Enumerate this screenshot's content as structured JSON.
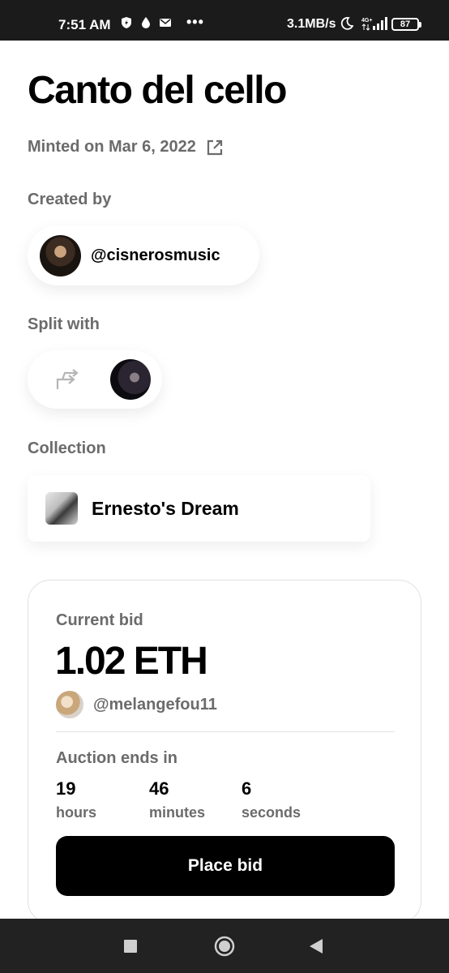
{
  "status_bar": {
    "time": "7:51 AM",
    "dots": "•••",
    "speed": "3.1MB/s",
    "network": "4G+",
    "battery": "87"
  },
  "nft": {
    "title": "Canto del cello",
    "minted": "Minted on Mar 6, 2022"
  },
  "created_by": {
    "label": "Created by",
    "handle": "@cisnerosmusic"
  },
  "split_with": {
    "label": "Split with"
  },
  "collection": {
    "label": "Collection",
    "name": "Ernesto's Dream"
  },
  "auction": {
    "current_bid_label": "Current bid",
    "amount": "1.02 ETH",
    "bidder": "@melangefou11",
    "ends_label": "Auction ends in",
    "countdown": [
      {
        "value": "19",
        "unit": "hours"
      },
      {
        "value": "46",
        "unit": "minutes"
      },
      {
        "value": "6",
        "unit": "seconds"
      }
    ],
    "button_label": "Place bid"
  },
  "icons": [
    "external-link-icon",
    "split-arrow-icon",
    "square-nav-icon",
    "circle-home-icon",
    "triangle-back-icon"
  ]
}
